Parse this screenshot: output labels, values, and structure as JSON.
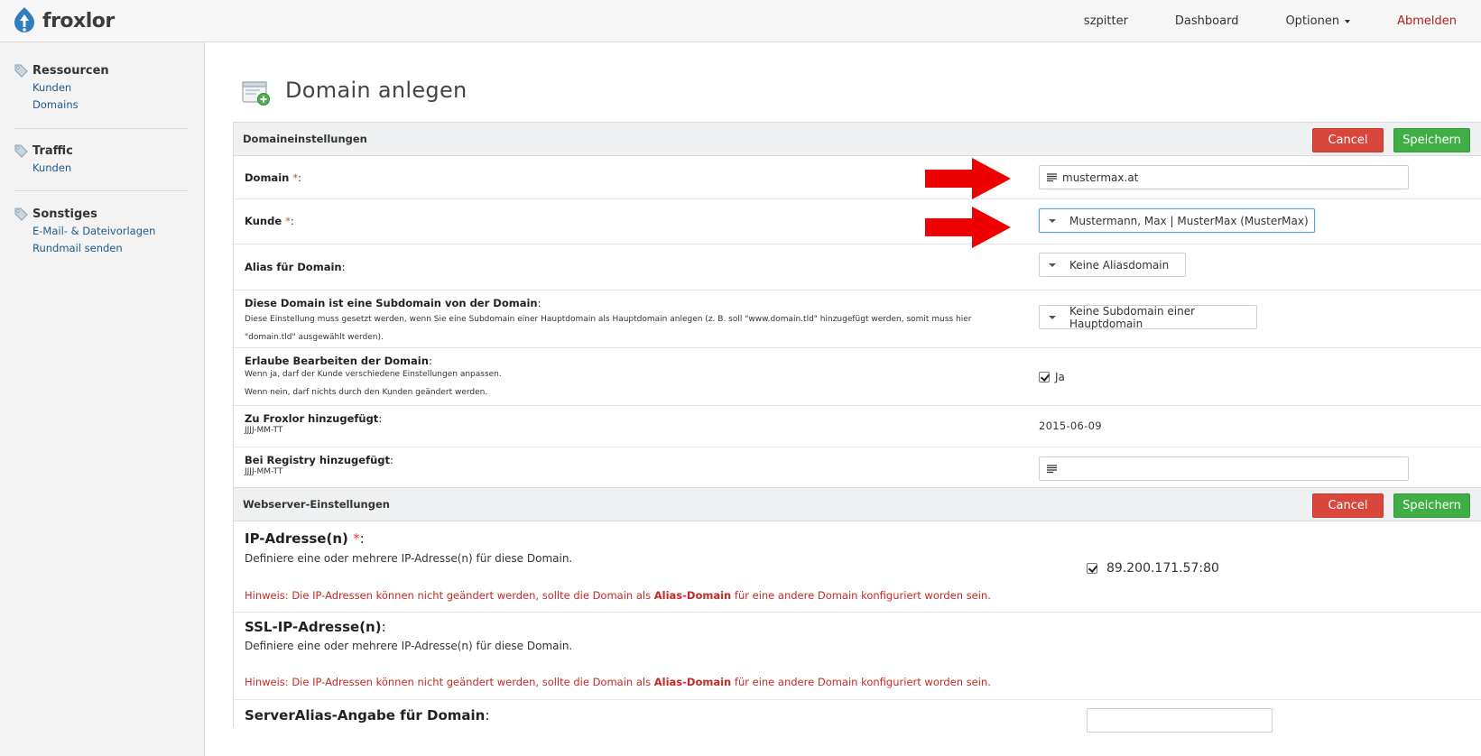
{
  "app": {
    "logo_text": "froxlor",
    "brand_color": "#2f7fbf"
  },
  "topnav": {
    "user": "szpitter",
    "dashboard": "Dashboard",
    "options": "Optionen",
    "logout": "Abmelden"
  },
  "sidebar": {
    "groups": [
      {
        "title": "Ressourcen",
        "items": [
          "Kunden",
          "Domains"
        ]
      },
      {
        "title": "Traffic",
        "items": [
          "Kunden"
        ]
      },
      {
        "title": "Sonstiges",
        "items": [
          "E-Mail- & Dateivorlagen",
          "Rundmail senden"
        ]
      }
    ]
  },
  "page": {
    "title": "Domain anlegen"
  },
  "buttons": {
    "cancel": "Cancel",
    "save": "Speichern"
  },
  "domain_settings": {
    "header": "Domaineinstellungen",
    "domain": {
      "label": "Domain",
      "required": "*",
      "colon": ":",
      "value": "mustermax.at"
    },
    "customer": {
      "label": "Kunde",
      "required": "*",
      "colon": ":",
      "value": "Mustermann, Max | MusterMax (MusterMax)"
    },
    "alias": {
      "label": "Alias für Domain",
      "colon": ":",
      "value": "Keine Aliasdomain"
    },
    "subdomain": {
      "label": "Diese Domain ist eine Subdomain von der Domain",
      "colon": ":",
      "desc_line1": "Diese Einstellung muss gesetzt werden, wenn Sie eine Subdomain einer Hauptdomain als Hauptdomain anlegen (z. B. soll \"www.domain.tld\" hinzugefügt werden, somit muss hier",
      "desc_line2": "\"domain.tld\" ausgewählt werden).",
      "value": "Keine Subdomain einer Hauptdomain"
    },
    "allow_edit": {
      "label": "Erlaube Bearbeiten der Domain",
      "colon": ":",
      "desc_line1": "Wenn ja, darf der Kunde verschiedene Einstellungen anpassen.",
      "desc_line2": "Wenn nein, darf nichts durch den Kunden geändert werden.",
      "checked": true,
      "option": "Ja"
    },
    "added_froxlor": {
      "label": "Zu Froxlor hinzugefügt",
      "colon": ":",
      "format": "JJJJ-MM-TT",
      "value": "2015-06-09"
    },
    "added_registry": {
      "label": "Bei Registry hinzugefügt",
      "colon": ":",
      "format": "JJJJ-MM-TT",
      "value": ""
    }
  },
  "webserver_settings": {
    "header": "Webserver-Einstellungen",
    "ip": {
      "label": "IP-Adresse(n)",
      "required": "*",
      "colon": ":",
      "desc": "Definiere eine oder mehrere IP-Adresse(n) für diese Domain.",
      "option": "89.200.171.57:80",
      "checked": true,
      "hint_before": "Hinweis: Die IP-Adressen können nicht geändert werden, sollte die Domain als ",
      "hint_bold": "Alias-Domain",
      "hint_after": " für eine andere Domain konfiguriert worden sein."
    },
    "ssl_ip": {
      "label": "SSL-IP-Adresse(n)",
      "colon": ":",
      "desc": "Definiere eine oder mehrere IP-Adresse(n) für diese Domain.",
      "hint_before": "Hinweis: Die IP-Adressen können nicht geändert werden, sollte die Domain als ",
      "hint_bold": "Alias-Domain",
      "hint_after": " für eine andere Domain konfiguriert worden sein."
    },
    "server_alias": {
      "label": "ServerAlias-Angabe für Domain",
      "colon": ":"
    }
  },
  "colors": {
    "cancel": "#d9463c",
    "save": "#3fae45",
    "arrow": "#ee0000",
    "required": "#d9463c",
    "hint": "#c62828",
    "link": "#1e5a8a"
  }
}
